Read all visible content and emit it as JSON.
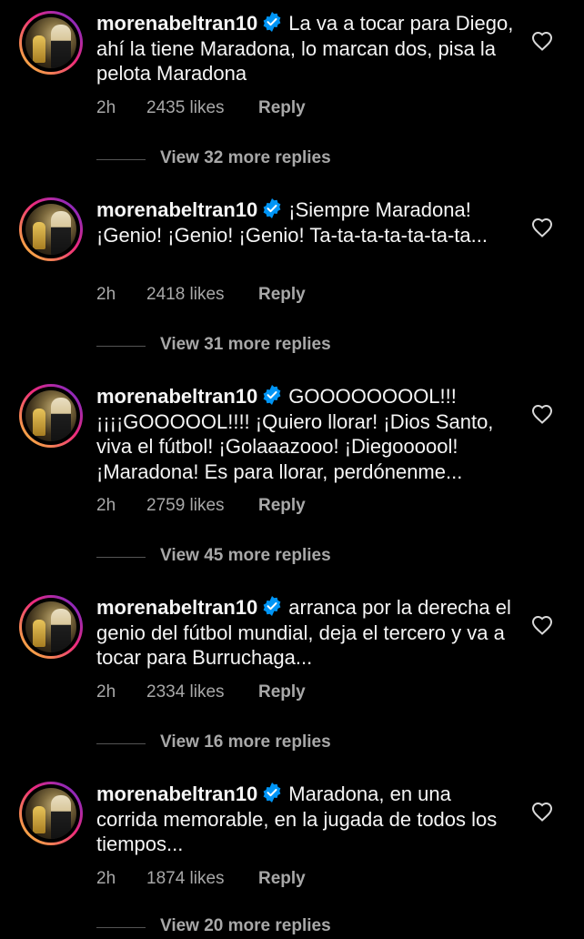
{
  "colors": {
    "background": "#000000",
    "text_primary": "#f5f5f5",
    "text_secondary": "#a8a8a8",
    "verified": "#0095f6",
    "story_ring": [
      "#f9ce34",
      "#ee2a7b",
      "#6228d7"
    ]
  },
  "comments": [
    {
      "username": "morenabeltran10",
      "verified_icon": "verified-badge-icon",
      "text": "La va a tocar para Diego, ahí la tiene Maradona, lo marcan dos, pisa la pelota Maradona",
      "time": "2h",
      "likes": "2435 likes",
      "reply_label": "Reply",
      "view_replies": "View 32 more replies",
      "like_icon": "heart-outline-icon"
    },
    {
      "username": "morenabeltran10",
      "verified_icon": "verified-badge-icon",
      "text": "¡Siempre Maradona! ¡Genio! ¡Genio! ¡Genio! Ta-ta-ta-ta-ta-ta-ta...",
      "time": "2h",
      "likes": "2418 likes",
      "reply_label": "Reply",
      "view_replies": "View 31 more replies",
      "like_icon": "heart-outline-icon"
    },
    {
      "username": "morenabeltran10",
      "verified_icon": "verified-badge-icon",
      "text": "GOOOOOOOOL!!! ¡¡¡¡GOOOOOL!!!! ¡Quiero llorar! ¡Dios Santo, viva el fútbol! ¡Golaaazooo! ¡Diegoooool! ¡Maradona! Es para llorar, perdónenme...",
      "time": "2h",
      "likes": "2759 likes",
      "reply_label": "Reply",
      "view_replies": "View 45 more replies",
      "like_icon": "heart-outline-icon"
    },
    {
      "username": "morenabeltran10",
      "verified_icon": "verified-badge-icon",
      "text": "arranca por la derecha el genio del fútbol mundial, deja el tercero y va a tocar para Burruchaga...",
      "time": "2h",
      "likes": "2334 likes",
      "reply_label": "Reply",
      "view_replies": "View 16 more replies",
      "like_icon": "heart-outline-icon"
    },
    {
      "username": "morenabeltran10",
      "verified_icon": "verified-badge-icon",
      "text": "Maradona, en una corrida memorable, en la jugada de todos los tiempos...",
      "time": "2h",
      "likes": "1874 likes",
      "reply_label": "Reply",
      "view_replies": "View 20 more replies",
      "like_icon": "heart-outline-icon"
    }
  ]
}
